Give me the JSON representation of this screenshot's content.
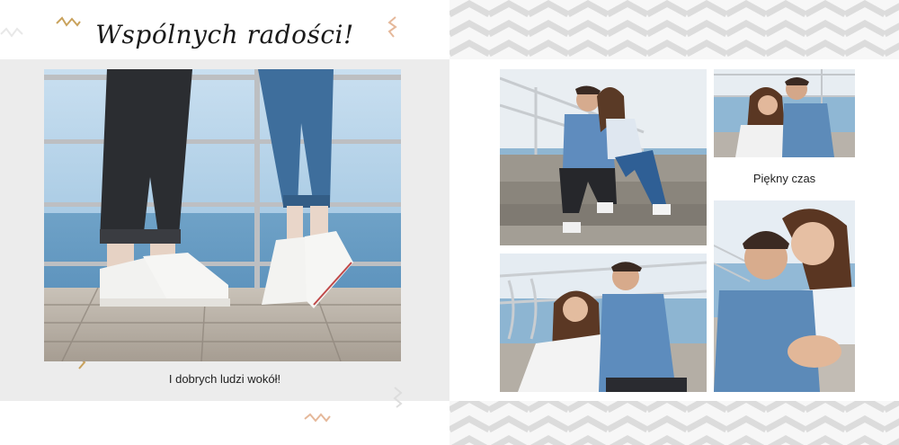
{
  "left_page": {
    "title": "Wspólnych radości!",
    "caption": "I dobrych ludzi wokół!"
  },
  "right_page": {
    "caption": "Piękny czas"
  },
  "photos": [
    {
      "id": "photo-sneakers",
      "description": "two people standing on tiptoe on a wooden pier by the sea"
    },
    {
      "id": "photo-couple-steps",
      "description": "couple sitting on stone steps by the sea"
    },
    {
      "id": "photo-couple-railing",
      "description": "couple sitting by a white railing"
    },
    {
      "id": "photo-couple-pier",
      "description": "couple sitting on a pier with railing"
    },
    {
      "id": "photo-couple-closeup",
      "description": "smiling couple close-up"
    }
  ],
  "colors": {
    "panel_gray": "#ececec",
    "chevron": "#d9d9d9",
    "accent_gold": "#c9a25c"
  }
}
